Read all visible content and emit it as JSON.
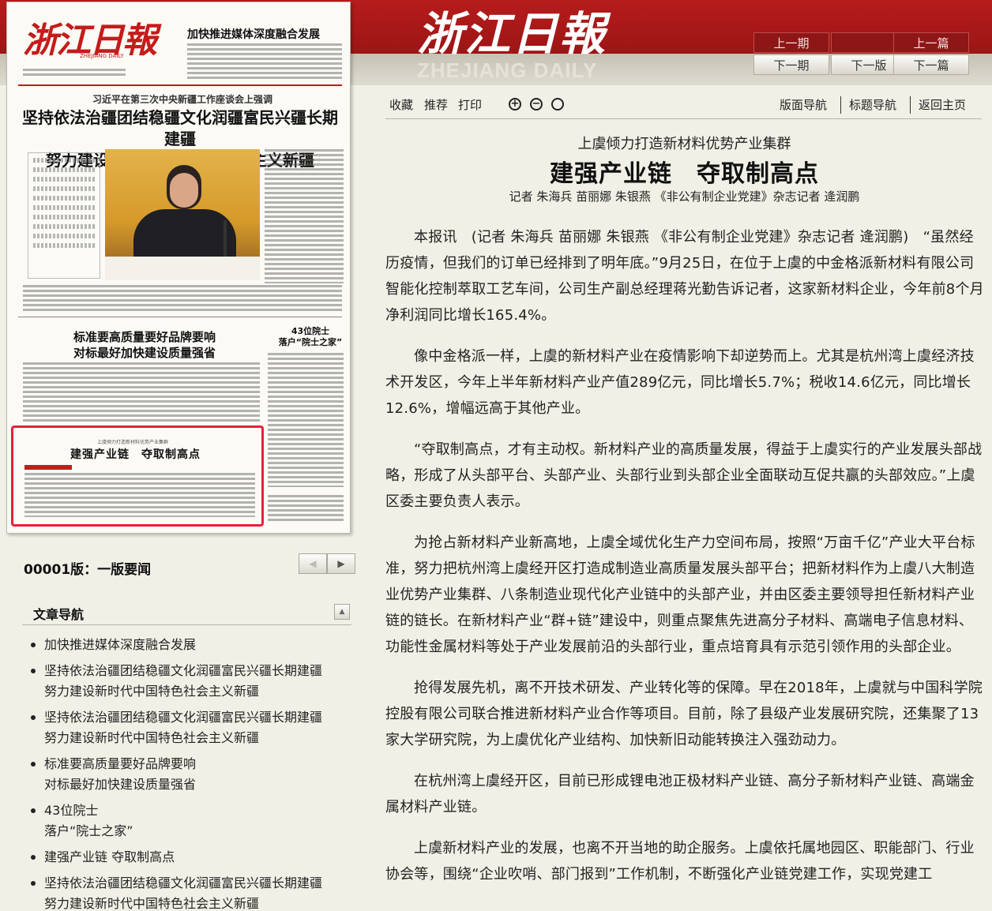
{
  "header": {
    "masthead_cn": "浙江日報",
    "masthead_en": "ZHEJIANG DAILY",
    "nav": {
      "prev_issue": "上一期",
      "blank": "",
      "prev_article": "上一篇",
      "next_issue": "下一期",
      "next_page": "下一版",
      "next_article": "下一篇"
    }
  },
  "paper_preview": {
    "logo": "浙江日報",
    "logo_en": "ZHEJIANG DAILY",
    "top_headline": "加快推进媒体深度融合发展",
    "kicker": "习近平在第三次中央新疆工作座谈会上强调",
    "main_headline_1": "坚持依法治疆团结稳疆文化润疆富民兴疆长期建疆",
    "main_headline_2": "努力建设新时代中国特色社会主义新疆",
    "sub_headline_1": "标准要高质量要好品牌要响",
    "sub_headline_2": "对标最好加快建设质量强省",
    "side_headline_1": "43位院士",
    "side_headline_2": "落户“院士之家”",
    "selected_kicker": "上虞倾力打造新材料优势产业集群",
    "selected_title": "建强产业链　夺取制高点"
  },
  "edition": {
    "label": "00001版：一版要闻",
    "prev": "◀",
    "next": "▶"
  },
  "article_nav": {
    "title": "文章导航",
    "collapse": "▲",
    "items": [
      {
        "line1": "加快推进媒体深度融合发展",
        "line2": ""
      },
      {
        "line1": "坚持依法治疆团结稳疆文化润疆富民兴疆长期建疆",
        "line2": "努力建设新时代中国特色社会主义新疆"
      },
      {
        "line1": "坚持依法治疆团结稳疆文化润疆富民兴疆长期建疆",
        "line2": "努力建设新时代中国特色社会主义新疆"
      },
      {
        "line1": "标准要高质量要好品牌要响",
        "line2": "对标最好加快建设质量强省"
      },
      {
        "line1": "43位院士",
        "line2": "落户“院士之家”"
      },
      {
        "line1": "建强产业链 夺取制高点",
        "line2": ""
      },
      {
        "line1": "坚持依法治疆团结稳疆文化润疆富民兴疆长期建疆",
        "line2": "努力建设新时代中国特色社会主义新疆"
      }
    ]
  },
  "toolbar": {
    "favorite": "收藏",
    "recommend": "推荐",
    "print": "打印",
    "zoom_in": "+",
    "zoom_out": "−",
    "zoom_reset": "",
    "page_nav": "版面导航",
    "title_nav": "标题导航",
    "home": "返回主页"
  },
  "article": {
    "pretitle": "上虞倾力打造新材料优势产业集群",
    "title": "建强产业链　夺取制高点",
    "byline": "记者 朱海兵 苗丽娜 朱银燕 《非公有制企业党建》杂志记者 逄润鹏",
    "paragraphs": [
      "本报讯　(记者 朱海兵 苗丽娜 朱银燕 《非公有制企业党建》杂志记者 逄润鹏)　“虽然经历疫情，但我们的订单已经排到了明年底。”9月25日，在位于上虞的中金格派新材料有限公司智能化控制萃取工艺车间，公司生产副总经理蒋光勤告诉记者，这家新材料企业，今年前8个月净利润同比增长165.4%。",
      "像中金格派一样，上虞的新材料产业在疫情影响下却逆势而上。尤其是杭州湾上虞经济技术开发区，今年上半年新材料产业产值289亿元，同比增长5.7%；税收14.6亿元，同比增长12.6%，增幅远高于其他产业。",
      "“夺取制高点，才有主动权。新材料产业的高质量发展，得益于上虞实行的产业发展头部战略，形成了从头部平台、头部产业、头部行业到头部企业全面联动互促共赢的头部效应。”上虞区委主要负责人表示。",
      "为抢占新材料产业新高地，上虞全域优化生产力空间布局，按照“万亩千亿”产业大平台标准，努力把杭州湾上虞经开区打造成制造业高质量发展头部平台；把新材料作为上虞八大制造业优势产业集群、八条制造业现代化产业链中的头部产业，并由区委主要领导担任新材料产业链的链长。在新材料产业“群+链”建设中，则重点聚焦先进高分子材料、高端电子信息材料、功能性金属材料等处于产业发展前沿的头部行业，重点培育具有示范引领作用的头部企业。",
      "抢得发展先机，离不开技术研发、产业转化等的保障。早在2018年，上虞就与中国科学院控股有限公司联合推进新材料产业合作等项目。目前，除了县级产业发展研究院，还集聚了13家大学研究院，为上虞优化产业结构、加快新旧动能转换注入强劲动力。",
      "在杭州湾上虞经开区，目前已形成锂电池正极材料产业链、高分子新材料产业链、高端金属材料产业链。",
      "上虞新材料产业的发展，也离不开当地的助企服务。上虞依托属地园区、职能部门、行业协会等，围绕“企业吹哨、部门报到”工作机制，不断强化产业链党建工作，实现党建工"
    ]
  }
}
